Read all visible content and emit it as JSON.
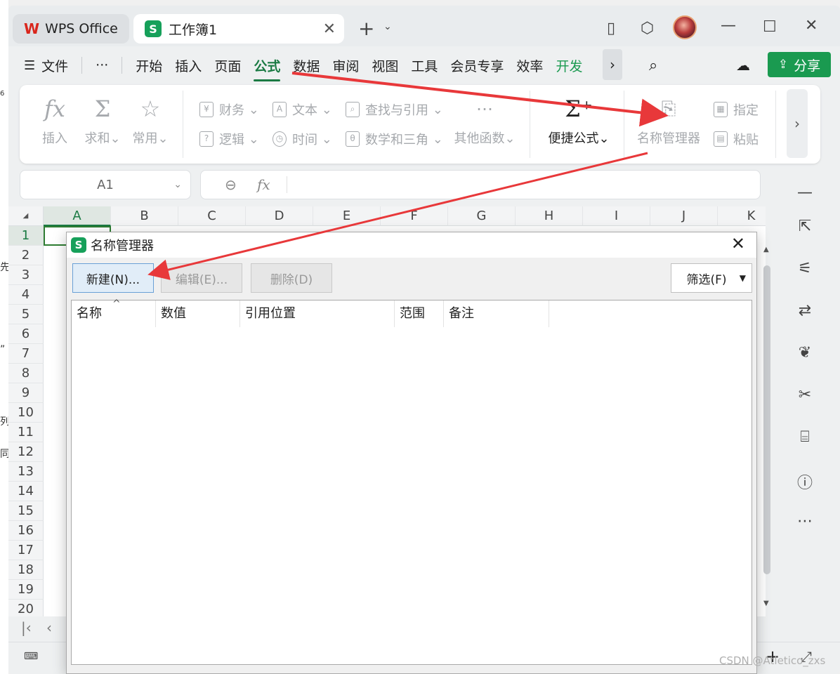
{
  "tabs": {
    "wps": "WPS Office",
    "workbook": "工作簿1",
    "add": "+"
  },
  "menu": {
    "file": "文件",
    "more": "···",
    "items": [
      "开始",
      "插入",
      "页面",
      "公式",
      "数据",
      "审阅",
      "视图",
      "工具",
      "会员专享",
      "效率"
    ],
    "active": "公式",
    "dev": "开发",
    "share": "分享"
  },
  "ribbon": {
    "insert_fn": "插入",
    "sum": "求和",
    "common": "常用",
    "finance": "财务",
    "text": "文本",
    "lookup": "查找与引用",
    "logic": "逻辑",
    "time": "时间",
    "math": "数学和三角",
    "other": "其他函数",
    "quick_formula": "便捷公式",
    "name_manager": "名称管理器",
    "specify": "指定",
    "paste": "粘贴"
  },
  "namebox": {
    "value": "A1"
  },
  "grid": {
    "columns": [
      "A",
      "B",
      "C",
      "D",
      "E",
      "F",
      "G",
      "H",
      "I",
      "J",
      "K"
    ],
    "rows": [
      "1",
      "2",
      "3",
      "4",
      "5",
      "6",
      "7",
      "8",
      "9",
      "10",
      "11",
      "12",
      "13",
      "14",
      "15",
      "16",
      "17",
      "18",
      "19",
      "20"
    ],
    "selected_column": "A",
    "selected_row": "1"
  },
  "dialog": {
    "title": "名称管理器",
    "new_btn": "新建(N)...",
    "edit_btn": "编辑(E)...",
    "delete_btn": "删除(D)",
    "filter_btn": "筛选(F)",
    "columns": [
      "名称",
      "数值",
      "引用位置",
      "范围",
      "备注"
    ]
  },
  "background_chars": [
    "6",
    "先",
    "”",
    "列",
    "同"
  ],
  "watermark": "CSDN @Atletico_zxs",
  "colors": {
    "accent_green": "#1a7a43",
    "share_green": "#1a9a50",
    "arrow_red": "#e8383a"
  }
}
